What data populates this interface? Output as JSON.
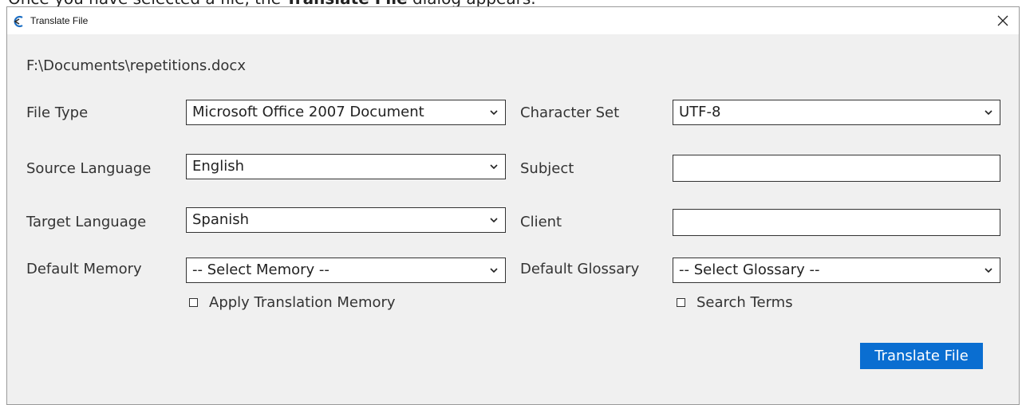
{
  "caption": {
    "before": "Once you have selected a file, the ",
    "bold": "Translate File",
    "after": " dialog appears."
  },
  "window": {
    "title": "Translate File",
    "file_path": "F:\\Documents\\repetitions.docx"
  },
  "form": {
    "file_type": {
      "label": "File Type",
      "value": "Microsoft Office 2007 Document"
    },
    "character_set": {
      "label": "Character Set",
      "value": "UTF-8"
    },
    "source_language": {
      "label": "Source Language",
      "value": "English"
    },
    "subject": {
      "label": "Subject",
      "value": ""
    },
    "target_language": {
      "label": "Target Language",
      "value": "Spanish"
    },
    "client": {
      "label": "Client",
      "value": ""
    },
    "default_memory": {
      "label": "Default Memory",
      "value": "-- Select Memory --"
    },
    "default_glossary": {
      "label": "Default Glossary",
      "value": "-- Select Glossary --"
    },
    "apply_tm": {
      "label": "Apply Translation Memory",
      "checked": false
    },
    "search_terms": {
      "label": "Search Terms",
      "checked": false
    }
  },
  "buttons": {
    "translate": "Translate File"
  },
  "colors": {
    "primary": "#0a6ed1",
    "background": "#f0f0f0",
    "titlebar": "#ffffff"
  },
  "icons": {
    "app": "translate-app-icon",
    "close": "close-icon",
    "dropdown": "chevron-down-icon"
  }
}
